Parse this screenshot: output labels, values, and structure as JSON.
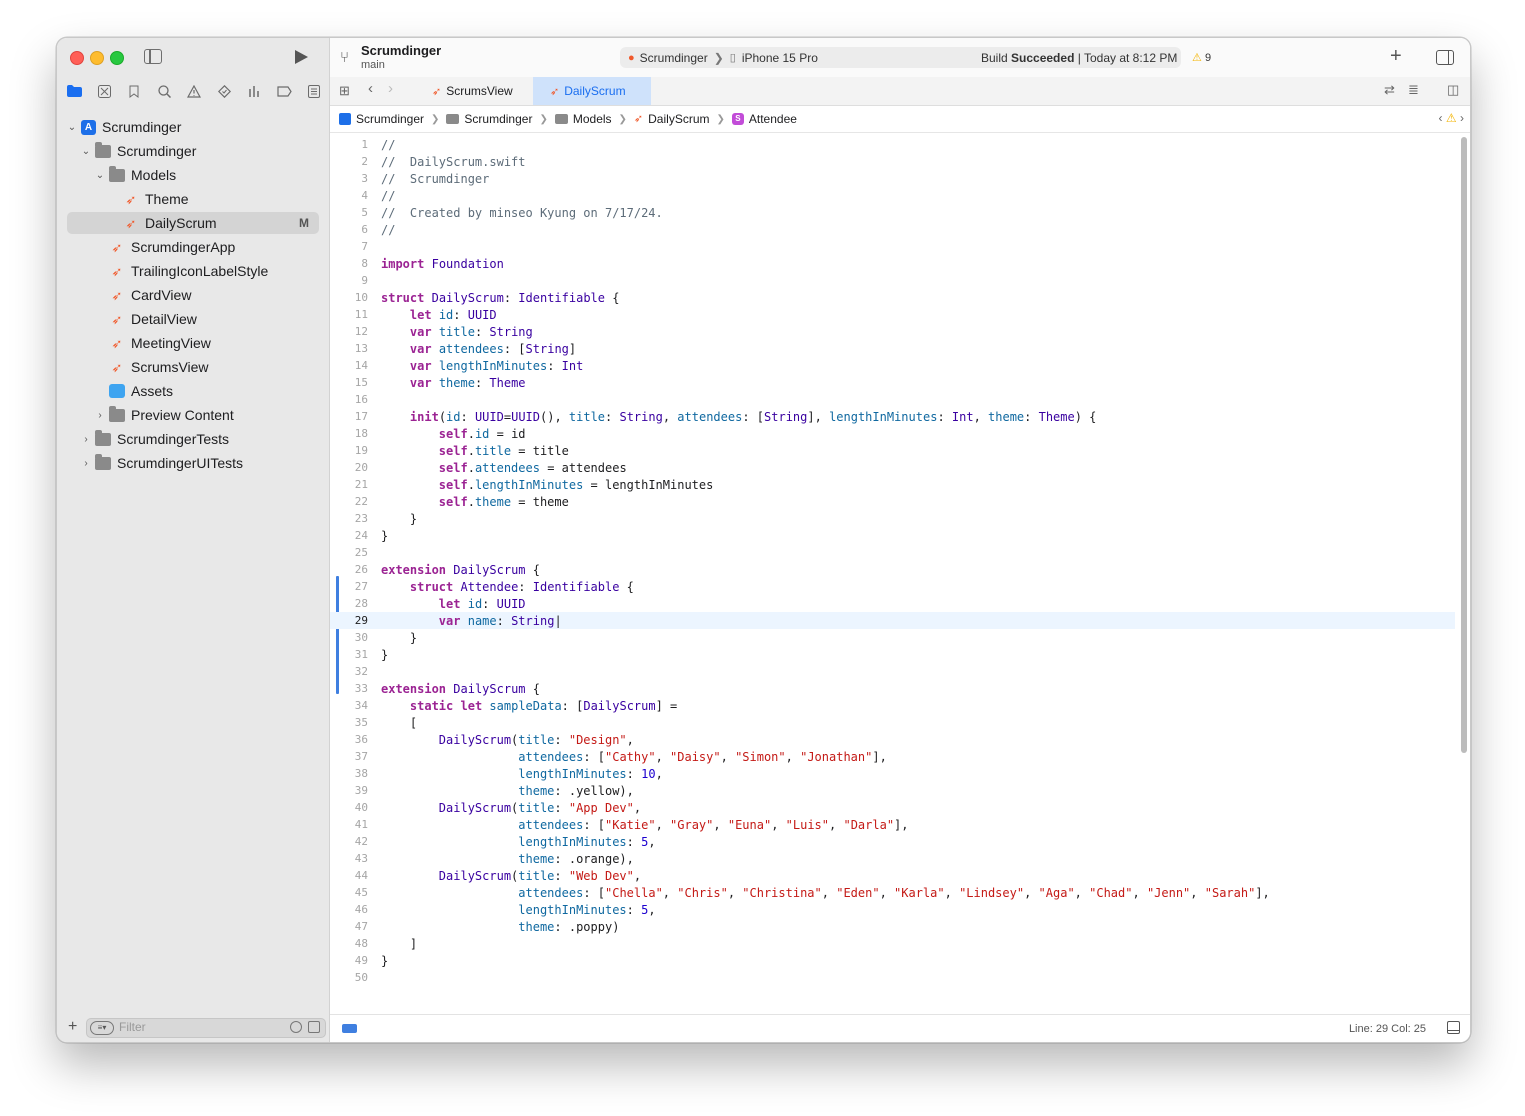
{
  "toolbar": {
    "project": "Scrumdinger",
    "branch": "main",
    "scheme": "Scrumdinger",
    "device": "iPhone 15 Pro",
    "build_prefix": "Build ",
    "build_state": "Succeeded",
    "build_time": " | Today at 8:12 PM",
    "warnings": "9"
  },
  "tabs": [
    "ScrumsView",
    "DailyScrum"
  ],
  "breadcrumb": [
    "Scrumdinger",
    "Scrumdinger",
    "Models",
    "DailyScrum",
    "Attendee"
  ],
  "navigator": {
    "items": [
      {
        "label": "Scrumdinger",
        "icon": "project-icon",
        "level": 0,
        "chevron": "v"
      },
      {
        "label": "Scrumdinger",
        "icon": "folder-icon",
        "level": 1,
        "chevron": "v"
      },
      {
        "label": "Models",
        "icon": "folder-icon",
        "level": 2,
        "chevron": "v"
      },
      {
        "label": "Theme",
        "icon": "swift-file-icon",
        "level": 3,
        "chevron": ""
      },
      {
        "label": "DailyScrum",
        "icon": "swift-file-icon",
        "level": 3,
        "chevron": "",
        "selected": true,
        "badge": "M"
      },
      {
        "label": "ScrumdingerApp",
        "icon": "swift-file-icon",
        "level": 2,
        "chevron": ""
      },
      {
        "label": "TrailingIconLabelStyle",
        "icon": "swift-file-icon",
        "level": 2,
        "chevron": ""
      },
      {
        "label": "CardView",
        "icon": "swift-file-icon",
        "level": 2,
        "chevron": ""
      },
      {
        "label": "DetailView",
        "icon": "swift-file-icon",
        "level": 2,
        "chevron": ""
      },
      {
        "label": "MeetingView",
        "icon": "swift-file-icon",
        "level": 2,
        "chevron": ""
      },
      {
        "label": "ScrumsView",
        "icon": "swift-file-icon",
        "level": 2,
        "chevron": ""
      },
      {
        "label": "Assets",
        "icon": "assets-icon",
        "level": 2,
        "chevron": ""
      },
      {
        "label": "Preview Content",
        "icon": "folder-icon",
        "level": 2,
        "chevron": ">"
      },
      {
        "label": "ScrumdingerTests",
        "icon": "folder-icon",
        "level": 1,
        "chevron": ">"
      },
      {
        "label": "ScrumdingerUITests",
        "icon": "folder-icon",
        "level": 1,
        "chevron": ">"
      }
    ],
    "filter_placeholder": "Filter"
  },
  "editor": {
    "current_line": 29,
    "lines": [
      "//",
      "//  DailyScrum.swift",
      "//  Scrumdinger",
      "//",
      "//  Created by minseo Kyung on 7/17/24.",
      "//",
      "",
      "import Foundation",
      "",
      "struct DailyScrum: Identifiable {",
      "    let id: UUID",
      "    var title: String",
      "    var attendees: [String]",
      "    var lengthInMinutes: Int",
      "    var theme: Theme",
      "",
      "    init(id: UUID=UUID(), title: String, attendees: [String], lengthInMinutes: Int, theme: Theme) {",
      "        self.id = id",
      "        self.title = title",
      "        self.attendees = attendees",
      "        self.lengthInMinutes = lengthInMinutes",
      "        self.theme = theme",
      "    }",
      "}",
      "",
      "extension DailyScrum {",
      "    struct Attendee: Identifiable {",
      "        let id: UUID",
      "        var name: String|",
      "    }",
      "}",
      "",
      "extension DailyScrum {",
      "    static let sampleData: [DailyScrum] =",
      "    [",
      "        DailyScrum(title: \"Design\",",
      "                   attendees: [\"Cathy\", \"Daisy\", \"Simon\", \"Jonathan\"],",
      "                   lengthInMinutes: 10,",
      "                   theme: .yellow),",
      "        DailyScrum(title: \"App Dev\",",
      "                   attendees: [\"Katie\", \"Gray\", \"Euna\", \"Luis\", \"Darla\"],",
      "                   lengthInMinutes: 5,",
      "                   theme: .orange),",
      "        DailyScrum(title: \"Web Dev\",",
      "                   attendees: [\"Chella\", \"Chris\", \"Christina\", \"Eden\", \"Karla\", \"Lindsey\", \"Aga\", \"Chad\", \"Jenn\", \"Sarah\"],",
      "                   lengthInMinutes: 5,",
      "                   theme: .poppy)",
      "    ]",
      "}",
      ""
    ]
  },
  "status": {
    "position": "Line: 29  Col: 25"
  }
}
